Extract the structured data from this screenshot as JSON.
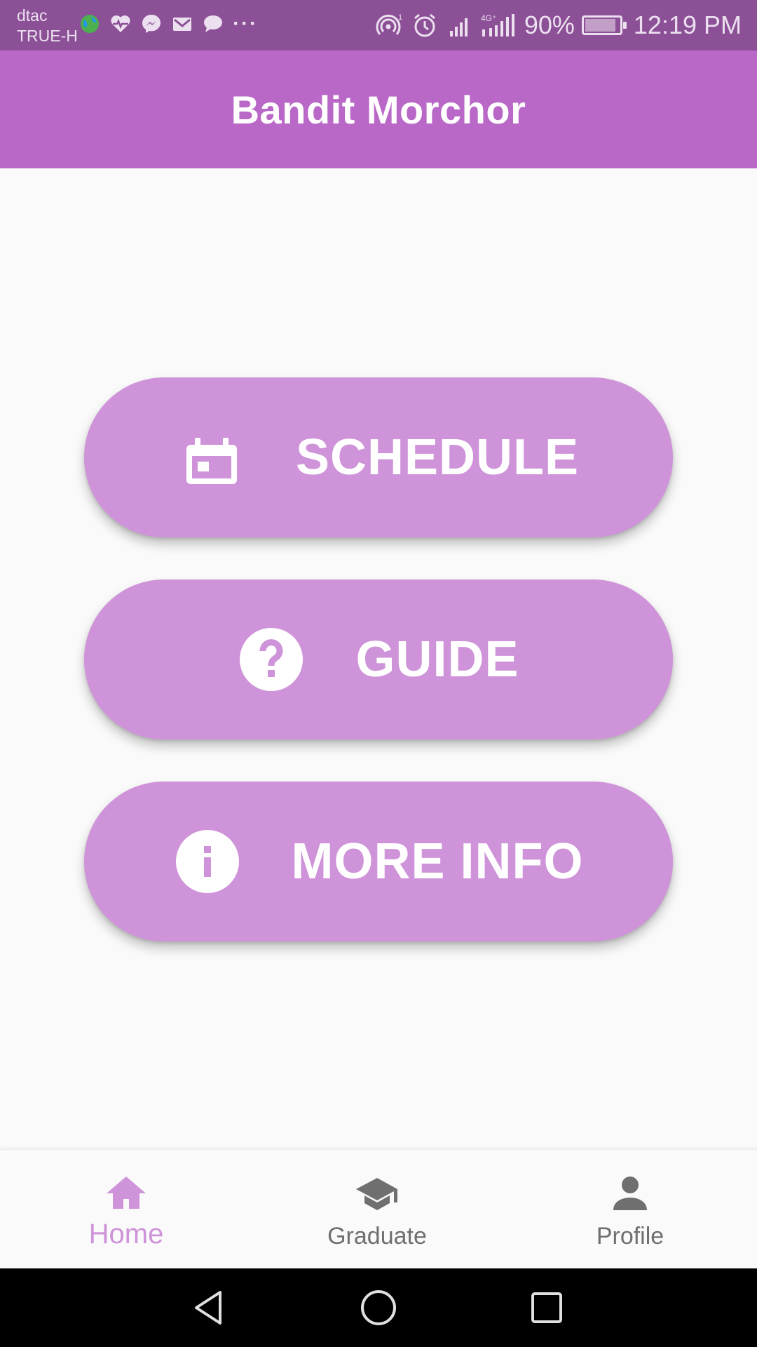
{
  "status_bar": {
    "carrier_1": "dtac",
    "carrier_2": "TRUE-H",
    "overflow": "···",
    "battery": "90%",
    "battery_level": 0.9,
    "time": "12:19 PM",
    "icons": [
      "globe-icon",
      "heart-pulse-icon",
      "messenger-icon",
      "mail-icon",
      "chat-icon",
      "hotspot-icon",
      "alarm-icon",
      "signal-icon",
      "signal-4g-icon",
      "battery-icon"
    ]
  },
  "app_bar": {
    "title": "Bandit Morchor"
  },
  "buttons": [
    {
      "label": "SCHEDULE",
      "icon": "calendar-icon"
    },
    {
      "label": "GUIDE",
      "icon": "help-circle-icon"
    },
    {
      "label": "MORE INFO",
      "icon": "info-circle-icon"
    }
  ],
  "bottom_nav": {
    "items": [
      {
        "label": "Home",
        "icon": "home-icon",
        "active": true
      },
      {
        "label": "Graduate",
        "icon": "graduation-cap-icon",
        "active": false
      },
      {
        "label": "Profile",
        "icon": "person-icon",
        "active": false
      }
    ]
  },
  "system_nav": {
    "icons": [
      "back-icon",
      "home-circle-icon",
      "recents-icon"
    ]
  },
  "colors": {
    "status_bar": "#8c5096",
    "app_bar": "#b968c7",
    "button": "#ce93d8",
    "active_nav": "#ce93d8",
    "inactive_nav": "#6f6f6f"
  }
}
